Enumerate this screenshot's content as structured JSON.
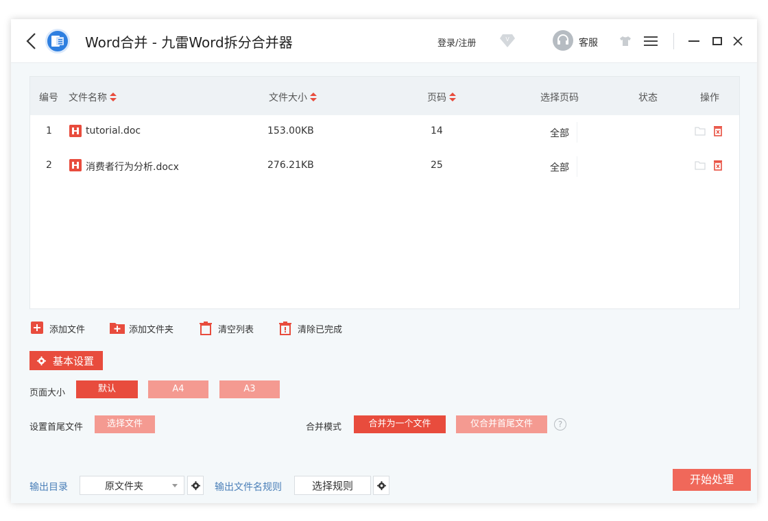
{
  "titlebar": {
    "title": "Word合并 - 九雷Word拆分合并器",
    "login": "登录/注册",
    "service": "客服"
  },
  "table": {
    "headers": {
      "index": "编号",
      "name": "文件名称",
      "size": "文件大小",
      "pages": "页码",
      "select_pages": "选择页码",
      "status": "状态",
      "action": "操作"
    },
    "rows": [
      {
        "index": "1",
        "name": "tutorial.doc",
        "size": "153.00KB",
        "pages": "14",
        "select": "全部",
        "status": ""
      },
      {
        "index": "2",
        "name": "消费者行为分析.docx",
        "size": "276.21KB",
        "pages": "25",
        "select": "全部",
        "status": ""
      }
    ]
  },
  "actions": {
    "add_file": "添加文件",
    "add_folder": "添加文件夹",
    "clear_list": "清空列表",
    "clear_done": "清除已完成"
  },
  "settings": {
    "title": "基本设置",
    "page_size_label": "页面大小",
    "page_size_options": [
      "默认",
      "A4",
      "A3"
    ],
    "page_size_selected": "默认",
    "head_tail_label": "设置首尾文件",
    "choose_file": "选择文件",
    "merge_mode_label": "合并模式",
    "merge_options": [
      "合并为一个文件",
      "仅合并首尾文件"
    ],
    "merge_selected": "合并为一个文件",
    "help": "?"
  },
  "output": {
    "dir_label": "输出目录",
    "dir_value": "原文件夹",
    "name_rule_label": "输出文件名规则",
    "rule_button": "选择规则",
    "start": "开始处理"
  },
  "colors": {
    "accent": "#e84c3d",
    "accent_light": "#f49a91",
    "link_blue": "#4a7fb8",
    "app_blue": "#2e7fe0"
  }
}
